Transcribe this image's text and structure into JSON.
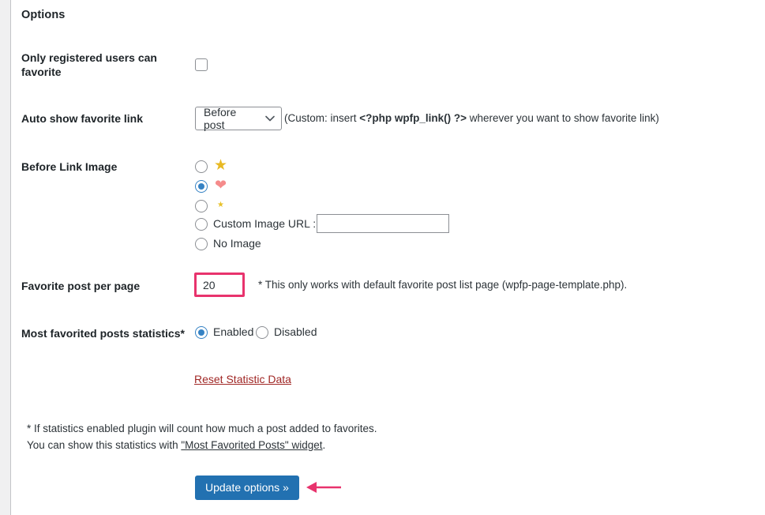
{
  "page": {
    "heading": "Options"
  },
  "rows": {
    "only_registered": {
      "label": "Only registered users can favorite",
      "checkbox_checked": false
    },
    "auto_show": {
      "label": "Auto show favorite link",
      "select_value": "Before post",
      "note_prefix": "(Custom: insert ",
      "note_code": "<?php wpfp_link() ?>",
      "note_suffix": " wherever you want to show favorite link)"
    },
    "before_link_image": {
      "label": "Before Link Image",
      "options": [
        {
          "id": "star-large",
          "icon": "star-large-icon",
          "label": "",
          "selected": false
        },
        {
          "id": "heart",
          "icon": "heart-icon",
          "label": "",
          "selected": true
        },
        {
          "id": "star-small",
          "icon": "star-small-icon",
          "label": "",
          "selected": false
        },
        {
          "id": "custom-url",
          "icon": "",
          "label": "Custom Image URL :",
          "selected": false
        },
        {
          "id": "no-image",
          "icon": "",
          "label": "No Image",
          "selected": false
        }
      ],
      "custom_url_value": "",
      "custom_url_placeholder": ""
    },
    "per_page": {
      "label": "Favorite post per page",
      "value": "20",
      "note": "* This only works with default favorite post list page (wpfp-page-template.php)."
    },
    "statistics": {
      "label": "Most favorited posts statistics*",
      "options": [
        {
          "id": "enabled",
          "label": "Enabled",
          "selected": true
        },
        {
          "id": "disabled",
          "label": "Disabled",
          "selected": false
        }
      ]
    },
    "reset_link": {
      "label": "Reset Statistic Data"
    }
  },
  "footnote": {
    "line1": "* If statistics enabled plugin will count how much a post added to favorites.",
    "line2_prefix": "You can show this statistics with ",
    "line2_link": "\"Most Favorited Posts\" widget",
    "line2_suffix": "."
  },
  "submit": {
    "label": "Update options »"
  },
  "annotation": {
    "arrow": "left-arrow-annotation"
  },
  "colors": {
    "button_blue": "#2271b1",
    "highlight_pink": "#e8336d",
    "radio_blue": "#3582c4",
    "reset_link_red": "#a02725"
  }
}
